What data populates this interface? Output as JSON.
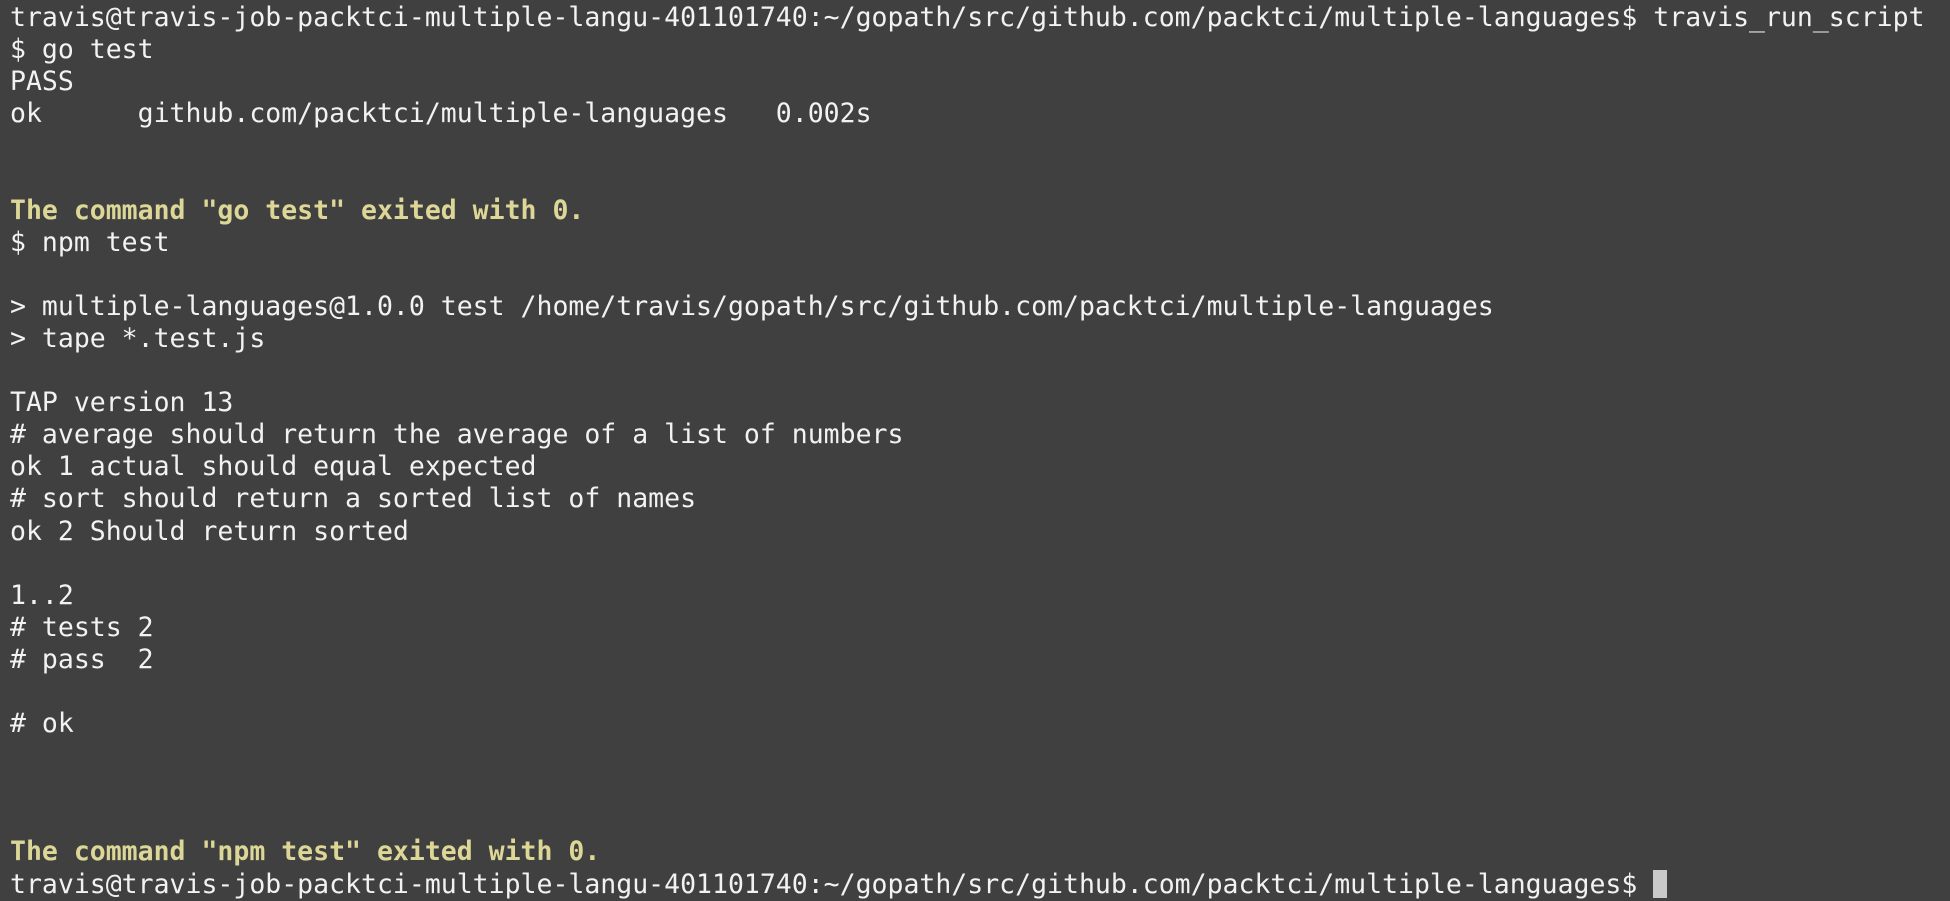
{
  "terminal": {
    "lines": [
      "travis@travis-job-packtci-multiple-langu-401101740:~/gopath/src/github.com/packtci/multiple-languages$ travis_run_script",
      "$ go test",
      "PASS",
      "ok      github.com/packtci/multiple-languages   0.002s",
      "",
      "",
      "The command \"go test\" exited with 0.",
      "$ npm test",
      "",
      "> multiple-languages@1.0.0 test /home/travis/gopath/src/github.com/packtci/multiple-languages",
      "> tape *.test.js",
      "",
      "TAP version 13",
      "# average should return the average of a list of numbers",
      "ok 1 actual should equal expected",
      "# sort should return a sorted list of names",
      "ok 2 Should return sorted",
      "",
      "1..2",
      "# tests 2",
      "# pass  2",
      "",
      "# ok",
      "",
      "",
      "",
      "The command \"npm test\" exited with 0."
    ],
    "prompt": "travis@travis-job-packtci-multiple-langu-401101740:~/gopath/src/github.com/packtci/multiple-languages$ ",
    "colors": {
      "background": "#404040",
      "text": "#f2f2f2",
      "status": "#dcd797",
      "cursor": "#c9c9c9"
    }
  }
}
